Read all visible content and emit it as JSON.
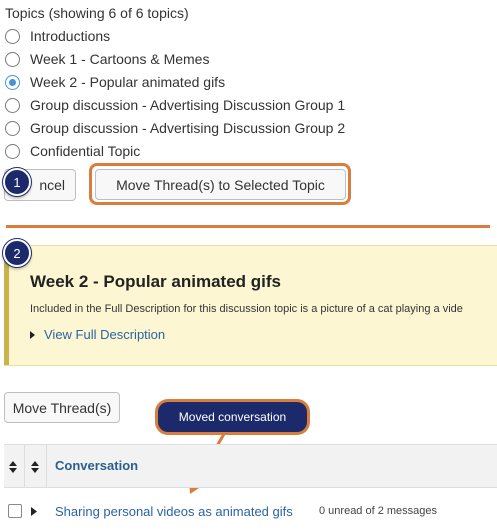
{
  "topics": {
    "header": "Topics (showing 6 of 6 topics)",
    "options": [
      {
        "label": "Introductions",
        "selected": false
      },
      {
        "label": "Week 1 - Cartoons & Memes",
        "selected": false
      },
      {
        "label": "Week 2 - Popular animated gifs",
        "selected": true
      },
      {
        "label": "Group discussion - Advertising Discussion Group 1",
        "selected": false
      },
      {
        "label": "Group discussion - Advertising Discussion Group 2",
        "selected": false
      },
      {
        "label": "Confidential Topic",
        "selected": false
      }
    ]
  },
  "actions": {
    "cancel_label": "ncel",
    "move_to_topic_label": "Move Thread(s) to Selected Topic"
  },
  "steps": {
    "step1": "1",
    "step2": "2"
  },
  "topic_detail": {
    "title": "Week 2 - Popular animated gifs",
    "description": "Included in the Full Description for this discussion topic is a picture of a cat playing a vide",
    "view_full_label": "View Full Description"
  },
  "thread_actions": {
    "move_thread_label": "Move Thread(s)"
  },
  "callout": {
    "label": "Moved conversation"
  },
  "table": {
    "column_header": "Conversation",
    "rows": [
      {
        "title": "Sharing personal videos as animated gifs",
        "meta": "0 unread of 2 messages"
      }
    ]
  },
  "colors": {
    "accent_orange": "#d97d3e",
    "step_navy": "#1c2a6b",
    "radio_selected": "#4a90d9",
    "panel_yellow": "#fcf7d2",
    "link_blue": "#2b63a6"
  },
  "icons": [
    "radio-icon",
    "step-badge-icon",
    "caret-right-icon",
    "sort-icon",
    "checkbox-icon",
    "arrow-icon"
  ]
}
